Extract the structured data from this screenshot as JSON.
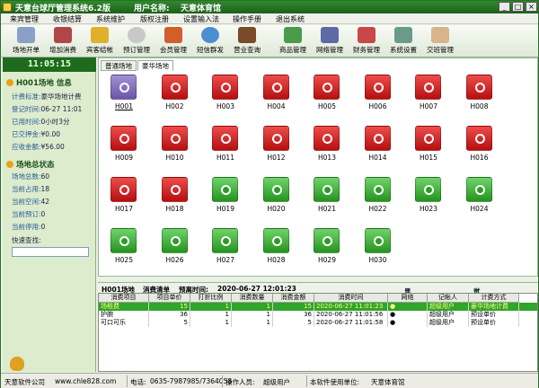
{
  "window": {
    "title": "天意台球厅管理系统6.2版",
    "user_label": "用户名称:",
    "user_value": "天意体育馆"
  },
  "menu": [
    "来宾管理",
    "收银结算",
    "系统维护",
    "版权注册",
    "设置输入法",
    "操作手册",
    "退出系统"
  ],
  "toolbar": [
    "场地开单",
    "增加消费",
    "宾客结帐",
    "预订管理",
    "会员管理",
    "短信群发",
    "营业查询",
    "商品管理",
    "网络管理",
    "财务管理",
    "系统设置",
    "交班管理"
  ],
  "clock": "11:05:15",
  "venue_info": {
    "heading": "H001场地 信息",
    "rows": [
      {
        "label": "计费标准:",
        "value": "豪华场地计费"
      },
      {
        "label": "登记时间:",
        "value": "06-27 11:01"
      },
      {
        "label": "已用时间:",
        "value": "0小时3分"
      },
      {
        "label": "已交押金:",
        "value": "¥0.00"
      },
      {
        "label": "应收金额:",
        "value": "¥56.00"
      }
    ]
  },
  "venue_status": {
    "heading": "场地总状态",
    "rows": [
      {
        "label": "场地总数:",
        "value": "60"
      },
      {
        "label": "当前占用:",
        "value": "18"
      },
      {
        "label": "当前空闲:",
        "value": "42"
      },
      {
        "label": "当前预订:",
        "value": "0"
      },
      {
        "label": "当前停用:",
        "value": "0"
      }
    ],
    "search_label": "快速查找:"
  },
  "tabs": [
    "普通场地",
    "豪华场地"
  ],
  "rooms": [
    {
      "id": "H001",
      "state": "sel"
    },
    {
      "id": "H002",
      "state": "busy"
    },
    {
      "id": "H003",
      "state": "busy"
    },
    {
      "id": "H004",
      "state": "busy"
    },
    {
      "id": "H005",
      "state": "busy"
    },
    {
      "id": "H006",
      "state": "busy"
    },
    {
      "id": "H007",
      "state": "busy"
    },
    {
      "id": "H008",
      "state": "busy"
    },
    {
      "id": "H009",
      "state": "busy"
    },
    {
      "id": "H010",
      "state": "busy"
    },
    {
      "id": "H011",
      "state": "busy"
    },
    {
      "id": "H012",
      "state": "busy"
    },
    {
      "id": "H013",
      "state": "busy"
    },
    {
      "id": "H014",
      "state": "busy"
    },
    {
      "id": "H015",
      "state": "busy"
    },
    {
      "id": "H016",
      "state": "busy"
    },
    {
      "id": "H017",
      "state": "busy"
    },
    {
      "id": "H018",
      "state": "busy"
    },
    {
      "id": "H019",
      "state": "free"
    },
    {
      "id": "H020",
      "state": "free"
    },
    {
      "id": "H021",
      "state": "free"
    },
    {
      "id": "H022",
      "state": "free"
    },
    {
      "id": "H023",
      "state": "free"
    },
    {
      "id": "H024",
      "state": "free"
    },
    {
      "id": "H025",
      "state": "free"
    },
    {
      "id": "H026",
      "state": "free"
    },
    {
      "id": "H027",
      "state": "free"
    },
    {
      "id": "H028",
      "state": "free"
    },
    {
      "id": "H029",
      "state": "free"
    },
    {
      "id": "H030",
      "state": "free"
    }
  ],
  "detail": {
    "room": "H001场地",
    "list_label": "消费清单",
    "settle_label": "预离时间:",
    "settle_value": "2020-06-27 12:01:23",
    "show_all": "显示全部",
    "filter": "过滤状态"
  },
  "grid": {
    "headers": [
      "消费项目",
      "项目单价",
      "打折比例",
      "消费数量",
      "消费金额",
      "消费时间",
      "网络",
      "记帐人",
      "计费方式"
    ],
    "rows": [
      [
        "场租费",
        "15",
        "1",
        "1",
        "15",
        "2020-06-27 11:01:23",
        "●",
        "超级用户",
        "豪华场地计费"
      ],
      [
        "护腕",
        "36",
        "1",
        "1",
        "36",
        "2020-06-27 11:01:56",
        "●",
        "超级用户",
        "预设单价"
      ],
      [
        "可口可乐",
        "5",
        "1",
        "1",
        "5",
        "2020-06-27 11:01:58",
        "●",
        "超级用户",
        "预设单价"
      ]
    ]
  },
  "status": {
    "company": "天意软件公司",
    "site": "www.chle828.com",
    "phone_label": "电话:",
    "phone": "0635-7987985/7364058",
    "operator_label": "操作人员:",
    "operator": "超级用户",
    "unit_label": "本软件使用单位:",
    "unit": "天意体育馆"
  },
  "colors": {
    "brand": "#1e5f1c",
    "busy": "#d62020",
    "free": "#2fa52a",
    "selected_row": "#2fa52a"
  }
}
